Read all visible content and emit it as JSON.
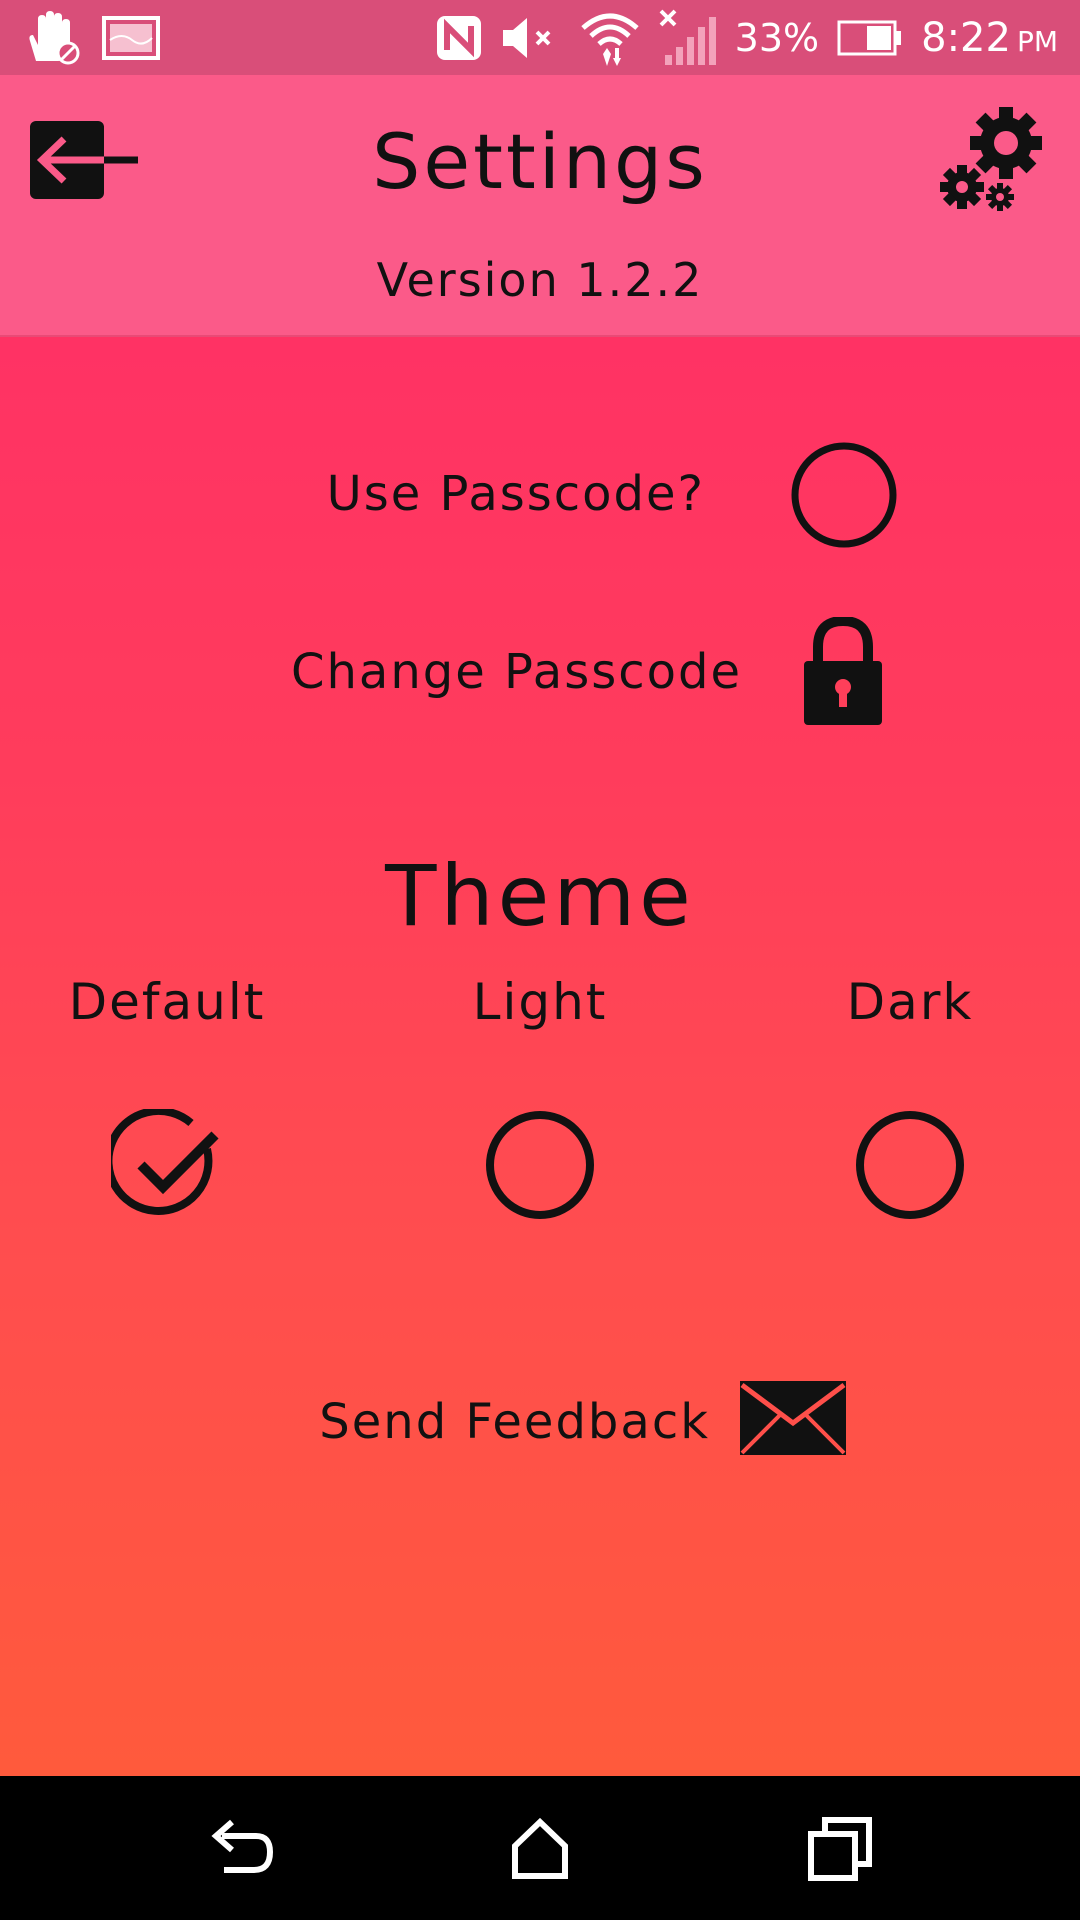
{
  "status_bar": {
    "battery_percent": "33%",
    "time": "8:22",
    "ampm": "PM",
    "icons": [
      "hand-blocked-icon",
      "gallery-icon",
      "nfc-icon",
      "mute-icon",
      "wifi-icon",
      "signal-off-icon",
      "battery-icon"
    ]
  },
  "header": {
    "title": "Settings",
    "version": "Version 1.2.2",
    "back_icon": "exit-arrow-icon",
    "settings_icon": "gears-icon"
  },
  "security": {
    "use_passcode_label": "Use Passcode?",
    "use_passcode_enabled": false,
    "change_passcode_label": "Change Passcode"
  },
  "theme": {
    "title": "Theme",
    "options": [
      {
        "label": "Default",
        "selected": true
      },
      {
        "label": "Light",
        "selected": false
      },
      {
        "label": "Dark",
        "selected": false
      }
    ]
  },
  "feedback": {
    "label": "Send Feedback"
  },
  "colors": {
    "status_bar": "#d94e79",
    "header": "#fb5a89",
    "gradient_top": "#ff3264",
    "gradient_bottom": "#ff5a3c",
    "text": "#111111"
  }
}
